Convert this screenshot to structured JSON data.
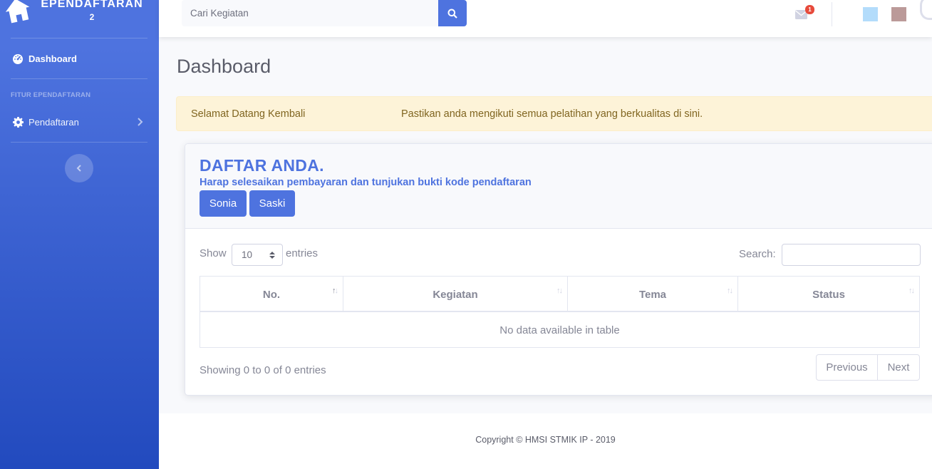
{
  "sidebar": {
    "brand": {
      "title": "EPENDAFTARAN",
      "subtitle": "2"
    },
    "items": [
      {
        "label": "Dashboard",
        "icon": "tachometer-icon"
      },
      {
        "label": "Pendaftaran",
        "icon": "gear-icon"
      }
    ],
    "heading": "FITUR EPENDAFTARAN",
    "toggle_icon": "chevron-left-icon"
  },
  "topbar": {
    "search_placeholder": "Cari Kegiatan",
    "mail_badge": "1",
    "colors": {
      "square_1": "#b3dcfb",
      "square_2": "#bb9a99"
    }
  },
  "main": {
    "page_title": "Dashboard",
    "alert": {
      "welcome": "Selamat Datang Kembali",
      "message": "Pastikan anda mengikuti semua pelatihan yang berkualitas di sini."
    },
    "card": {
      "title": "DAFTAR ANDA.",
      "subtitle": "Harap selesaikan pembayaran dan tunjukan bukti kode pendaftaran",
      "buttons": [
        "Sonia",
        "Saski"
      ]
    },
    "datatable": {
      "show_label": "Show",
      "length_value": "10",
      "entries_label": "entries",
      "search_label": "Search:",
      "columns": [
        "No.",
        "Kegiatan",
        "Tema",
        "Status"
      ],
      "empty_text": "No data available in table",
      "info": "Showing 0 to 0 of 0 entries",
      "previous": "Previous",
      "next": "Next"
    }
  },
  "footer": {
    "copyright": "Copyright © HMSI STMIK IP - 2019"
  },
  "colors": {
    "primary": "#4e73df",
    "alert_bg": "#fdf3d8",
    "alert_text": "#806520",
    "badge": "#e74a3b"
  }
}
